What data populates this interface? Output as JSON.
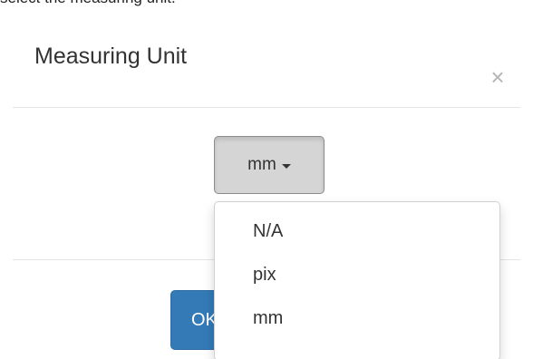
{
  "caption": "select the measuring unit.",
  "modal": {
    "title": "Measuring Unit",
    "close_label": "×"
  },
  "unit_select": {
    "selected_label": "mm",
    "options": [
      "N/A",
      "pix",
      "mm"
    ]
  },
  "footer": {
    "ok_label": "OK"
  }
}
